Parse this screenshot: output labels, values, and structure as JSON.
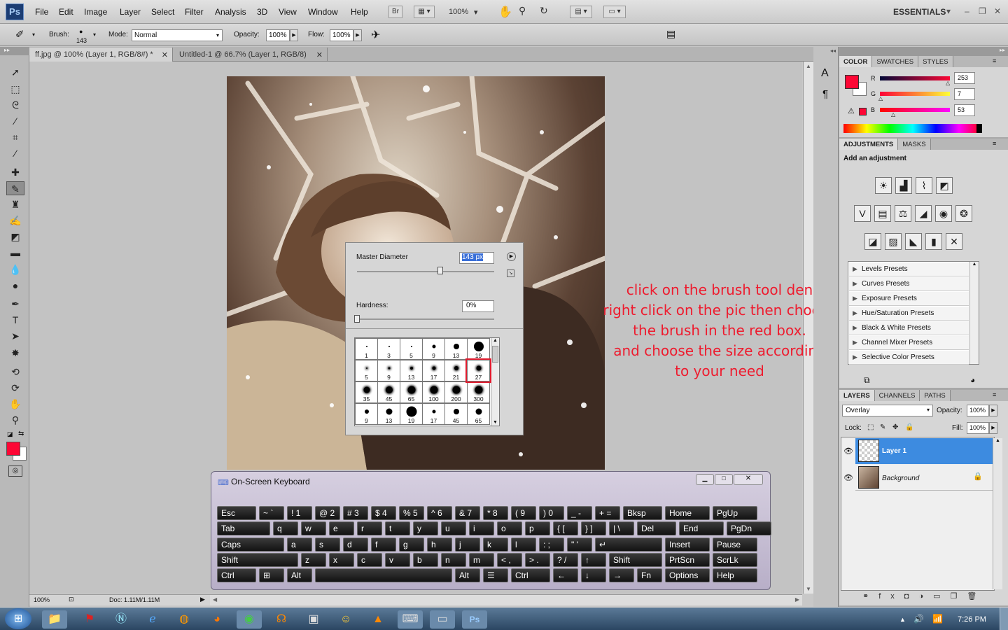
{
  "app": {
    "logo": "Ps"
  },
  "menu": [
    "File",
    "Edit",
    "Image",
    "Layer",
    "Select",
    "Filter",
    "Analysis",
    "3D",
    "View",
    "Window",
    "Help"
  ],
  "menubar": {
    "bridge": "Br",
    "zoom": "100%",
    "workspace": "ESSENTIALS"
  },
  "options": {
    "brush_label": "Brush:",
    "brush_size": "143",
    "mode_label": "Mode:",
    "mode_value": "Normal",
    "opacity_label": "Opacity:",
    "opacity_value": "100%",
    "flow_label": "Flow:",
    "flow_value": "100%"
  },
  "tabs": [
    {
      "label": "ff.jpg @ 100% (Layer 1, RGB/8#) *",
      "active": true
    },
    {
      "label": "Untitled-1 @ 66.7% (Layer 1, RGB/8)",
      "active": false
    }
  ],
  "status": {
    "zoom": "100%",
    "doc": "Doc: 1.11M/1.11M"
  },
  "brush_picker": {
    "master_diameter_label": "Master Diameter",
    "master_diameter_value": "143 px",
    "hardness_label": "Hardness:",
    "hardness_value": "0%",
    "presets": [
      {
        "n": "1",
        "d": 2
      },
      {
        "n": "3",
        "d": 2
      },
      {
        "n": "5",
        "d": 2
      },
      {
        "n": "9",
        "d": 5
      },
      {
        "n": "13",
        "d": 8
      },
      {
        "n": "19",
        "d": 14
      },
      {
        "n": "5",
        "d": 2
      },
      {
        "n": "9",
        "d": 3
      },
      {
        "n": "13",
        "d": 4
      },
      {
        "n": "17",
        "d": 5
      },
      {
        "n": "21",
        "d": 6
      },
      {
        "n": "27",
        "d": 7
      },
      {
        "n": "35",
        "d": 9
      },
      {
        "n": "45",
        "d": 10
      },
      {
        "n": "65",
        "d": 11
      },
      {
        "n": "100",
        "d": 11
      },
      {
        "n": "200",
        "d": 11
      },
      {
        "n": "300",
        "d": 11
      },
      {
        "n": "9",
        "d": 6
      },
      {
        "n": "13",
        "d": 9
      },
      {
        "n": "19",
        "d": 15
      },
      {
        "n": "17",
        "d": 5
      },
      {
        "n": "45",
        "d": 8
      },
      {
        "n": "65",
        "d": 9
      }
    ],
    "selected_index": 11
  },
  "annotation": {
    "lines": [
      "click on the brush tool den",
      "right click on the pic then choose",
      "the brush in the red box.",
      "and choose the size according",
      "to your need"
    ]
  },
  "color_panel": {
    "tabs": [
      "COLOR",
      "SWATCHES",
      "STYLES"
    ],
    "r_label": "R",
    "g_label": "G",
    "b_label": "B",
    "r": "253",
    "g": "7",
    "b": "53",
    "foreground": "#fd0735"
  },
  "adjustments_panel": {
    "tabs": [
      "ADJUSTMENTS",
      "MASKS"
    ],
    "heading": "Add an adjustment",
    "presets": [
      "Levels Presets",
      "Curves Presets",
      "Exposure Presets",
      "Hue/Saturation Presets",
      "Black & White Presets",
      "Channel Mixer Presets",
      "Selective Color Presets"
    ]
  },
  "layers_panel": {
    "tabs": [
      "LAYERS",
      "CHANNELS",
      "PATHS"
    ],
    "blend_mode": "Overlay",
    "opacity_label": "Opacity:",
    "opacity_value": "100%",
    "lock_label": "Lock:",
    "fill_label": "Fill:",
    "fill_value": "100%",
    "layers": [
      {
        "name": "Layer 1",
        "selected": true
      },
      {
        "name": "Background",
        "selected": false
      }
    ]
  },
  "osk": {
    "title": "On-Screen Keyboard",
    "rows": [
      [
        "Esc",
        "~ `",
        "! 1",
        "@ 2",
        "# 3",
        "$ 4",
        "% 5",
        "^ 6",
        "& 7",
        "* 8",
        "( 9",
        ") 0",
        "_ -",
        "+ =",
        "Bksp",
        "Home",
        "PgUp"
      ],
      [
        "Tab",
        "q",
        "w",
        "e",
        "r",
        "t",
        "y",
        "u",
        "i",
        "o",
        "p",
        "{ [",
        "} ]",
        "| \\",
        "Del",
        "End",
        "PgDn"
      ],
      [
        "Caps",
        "a",
        "s",
        "d",
        "f",
        "g",
        "h",
        "j",
        "k",
        "l",
        ": ;",
        "\" '",
        "↵",
        "Insert",
        "Pause"
      ],
      [
        "Shift",
        "z",
        "x",
        "c",
        "v",
        "b",
        "n",
        "m",
        "< ,",
        "> .",
        "? /",
        "↑",
        "Shift",
        "PrtScn",
        "ScrLk"
      ],
      [
        "Ctrl",
        "⊞",
        "Alt",
        "",
        "Alt",
        "☰",
        "Ctrl",
        "←",
        "↓",
        "→",
        "Fn",
        "Options",
        "Help"
      ]
    ]
  },
  "taskbar": {
    "time": "7:26 PM"
  }
}
